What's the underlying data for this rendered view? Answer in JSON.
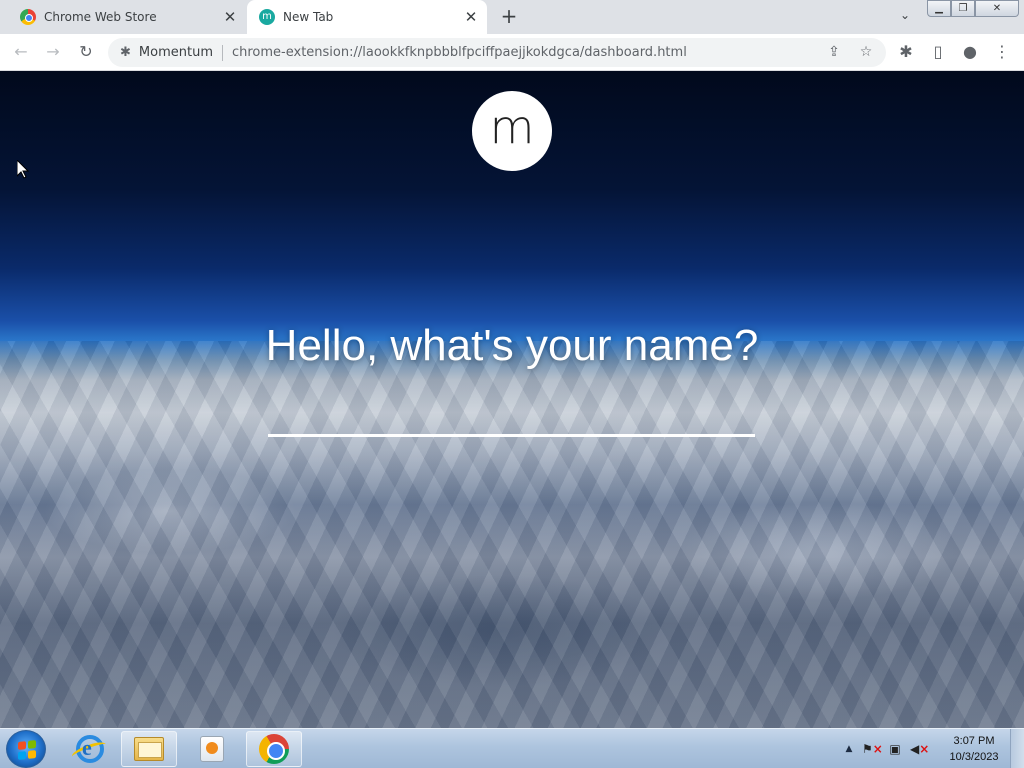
{
  "browser": {
    "tabs": [
      {
        "title": "Chrome Web Store",
        "icon": "chrome-web-store-icon",
        "active": false
      },
      {
        "title": "New Tab",
        "icon": "momentum-icon",
        "active": true
      }
    ],
    "new_tab_glyph": "+",
    "close_glyph": "✕",
    "tab_search_glyph": "⌄",
    "window_controls": {
      "minimize": "▁",
      "maximize": "❐",
      "close": "✕"
    },
    "toolbar": {
      "back_glyph": "←",
      "forward_glyph": "→",
      "reload_glyph": "↻",
      "extension_chip": "Momentum",
      "url": "chrome-extension://laookkfknpbbblfpciffpaejjkokdgca/dashboard.html",
      "share_glyph": "⇪",
      "bookmark_glyph": "☆",
      "extensions_glyph": "✱",
      "sidepanel_glyph": "▯",
      "profile_glyph": "●",
      "menu_glyph": "⋮"
    }
  },
  "momentum": {
    "logo_letter": "m",
    "greeting": "Hello, what's your name?",
    "name_input_value": ""
  },
  "taskbar": {
    "clock_time": "3:07 PM",
    "clock_date": "10/3/2023",
    "tray_arrow": "▲",
    "tray_icons": [
      "action-center-icon",
      "network-icon",
      "volume-muted-icon"
    ]
  },
  "colors": {
    "tab_strip": "#dee1e6",
    "momentum_teal": "#1aa9a0",
    "sky_top": "#01091c",
    "horizon_blue": "#2a75c8"
  }
}
